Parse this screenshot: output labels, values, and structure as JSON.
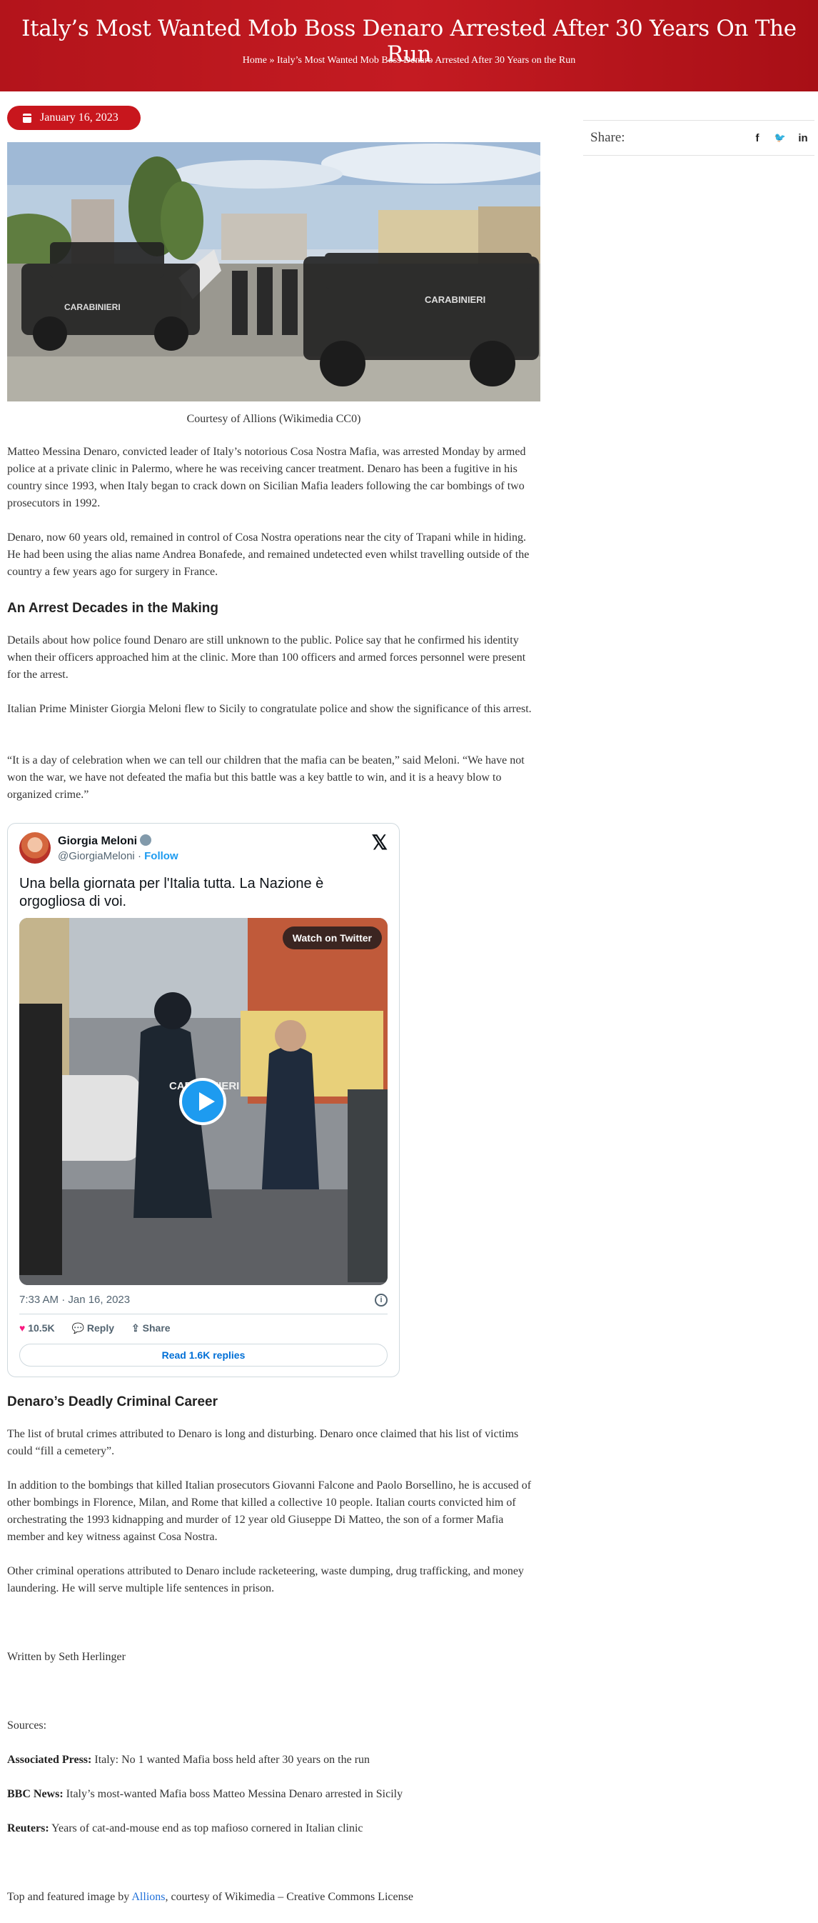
{
  "header": {
    "title": "Italy’s Most Wanted Mob Boss Denaro Arrested After 30 Years On The Run",
    "breadcrumb_home": "Home",
    "breadcrumb_sep": "»",
    "breadcrumb_current": "Italy’s Most Wanted Mob Boss Denaro Arrested After 30 Years on the Run"
  },
  "post": {
    "date": "January 16, 2023",
    "image_caption": "Courtesy of Allions (Wikimedia CC0)"
  },
  "sidebar": {
    "share_label": "Share:",
    "share_icons": [
      "facebook-icon",
      "twitter-icon",
      "linkedin-icon"
    ],
    "facebook_glyph": "f",
    "twitter_glyph": "🐦",
    "linkedin_glyph": "in"
  },
  "article": {
    "p1": "Matteo Messina Denaro, convicted leader of Italy’s notorious Cosa Nostra Mafia, was arrested Monday by armed police at a private clinic in Palermo, where he was receiving cancer treatment. Denaro has been a fugitive in his country since 1993, when Italy began to crack down on Sicilian Mafia leaders following the car bombings of two prosecutors in 1992.",
    "p2": "Denaro, now 60 years old, remained in control of Cosa Nostra operations near the city of Trapani while in hiding. He had been using the alias name Andrea Bonafede, and remained undetected even whilst travelling outside of the country a few years ago for surgery in France.",
    "h_arrest": "An Arrest Decades in the Making",
    "p3": "Details about how police found Denaro are still unknown to the public. Police say that he confirmed his identity when their officers approached him at the clinic. More than 100 officers and armed forces personnel were present for the arrest.",
    "p4": "Italian Prime Minister Giorgia Meloni flew to Sicily to congratulate police and show the significance of this arrest.",
    "p5": "“It is a day of celebration when we can tell our children that the mafia can be beaten,” said Meloni. “We have not won the war, we have not defeated the mafia but this battle was a key battle to win, and it is a heavy blow to organized crime.”",
    "h_career": "Denaro’s Deadly Criminal Career",
    "p6": "The list of brutal crimes attributed to Denaro is long and disturbing. Denaro once claimed that his list of victims could “fill a cemetery”.",
    "p7": "In addition to the bombings that killed Italian prosecutors Giovanni Falcone and Paolo Borsellino, he is accused of other bombings in Florence, Milan, and Rome that killed a collective 10 people. Italian courts convicted him of orchestrating the 1993 kidnapping and murder of 12 year old Giuseppe Di Matteo, the son of a former Mafia member and key witness against Cosa Nostra.",
    "p8": "Other criminal operations attributed to Denaro include racketeering, waste dumping, drug trafficking, and money laundering. He will serve multiple life sentences in prison.",
    "author": "Written by Seth Herlinger",
    "sources_label": "Sources:",
    "sources": [
      {
        "outlet": "Associated Press:",
        "title": "Italy: No 1 wanted Mafia boss held after 30 years on the run"
      },
      {
        "outlet": "BBC News:",
        "title": "Italy’s most-wanted Mafia boss Matteo Messina Denaro arrested in Sicily"
      },
      {
        "outlet": "Reuters:",
        "title": "Years of cat-and-mouse end as top mafioso cornered in Italian clinic"
      }
    ],
    "credit_prefix": "Top and featured image by ",
    "credit_link": "Allions",
    "credit_suffix": ", courtesy of Wikimedia – Creative Commons License"
  },
  "tweet": {
    "name": "Giorgia Meloni",
    "handle": "@GiorgiaMeloni",
    "sep": " · ",
    "follow": "Follow",
    "x_glyph": "𝕏",
    "text": "Una bella giornata per l'Italia tutta. La Nazione è orgogliosa di voi.",
    "watch_label": "Watch on Twitter",
    "timestamp": "7:33 AM · Jan 16, 2023",
    "info_glyph": "i",
    "likes": "10.5K",
    "reply_label": "Reply",
    "share_label": "Share",
    "heart_glyph": "♥",
    "reply_glyph": "💬",
    "share_glyph": "⇪",
    "read_replies": "Read 1.6K replies",
    "accent": "#1d9bf0"
  },
  "colors": {
    "banner": "#c41b22",
    "badge": "#c8161d",
    "link": "#1e6fd9"
  }
}
